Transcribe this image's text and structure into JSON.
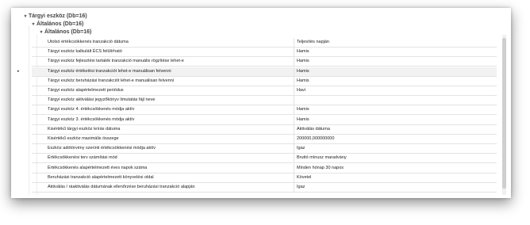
{
  "groups": [
    {
      "label": "Tárgyi eszköz (Db=16)",
      "chevron": "▾"
    },
    {
      "label": "Általános (Db=16)",
      "chevron": "▾"
    },
    {
      "label": "Általános (Db=16)",
      "chevron": "▾"
    }
  ],
  "row_indicator": "▸",
  "rows": [
    {
      "key": "Utolsó értékcsökkenés tranzakció dátuma",
      "value": "Teljesítés napján"
    },
    {
      "key": "Tárgyi eszköz kalkulált ÉCS felülírható",
      "value": "Hamis"
    },
    {
      "key": "Tárgyi eszköz fejlesztési tartalék tranzakció manuális rögzítése lehet-e",
      "value": "Hamis"
    },
    {
      "key": "Tárgyi eszköz értékelési tranzakciót lehet-e manuálisan felvenni",
      "value": "Hamis"
    },
    {
      "key": "Tárgyi eszköz beruházási tranzakciót lehet-e manuálisan felvenni",
      "value": "Hamis"
    },
    {
      "key": "Tárgyi eszköz alapértelmezett periódus",
      "value": "Havi"
    },
    {
      "key": "Tárgyi eszköz aktiválási jegyzőkönyv limutatás fájl neve",
      "value": ""
    },
    {
      "key": "Tárgyi eszköz 4. értékcsökkenés módja aktív",
      "value": "Hamis"
    },
    {
      "key": "Tárgyi eszköz 3. értékcsökkenés módja aktív",
      "value": "Hamis"
    },
    {
      "key": "Kisértékű tárgyi eszköz leírás dátuma",
      "value": "Aktiválás dátuma"
    },
    {
      "key": "Kisértékű eszköz maximális összege",
      "value": "200000,000000000"
    },
    {
      "key": "Eszköz adótörvény szerinti értékcsökkenési módja aktív",
      "value": "Igaz"
    },
    {
      "key": "Értékcsökkenési terv számítási mód",
      "value": "Bruttó mínusz maradvány"
    },
    {
      "key": "Értékcsökkenés alapértelmezett éves napok száma",
      "value": "Minden hónap 30 napos"
    },
    {
      "key": "Beruházási tranzakció alapértelmezett könyvelési oldal",
      "value": "Követel"
    },
    {
      "key": "Aktiválás / ráaktiválás dátumának ellenőrzése beruházási tranzakció alapján",
      "value": "Igaz"
    }
  ]
}
